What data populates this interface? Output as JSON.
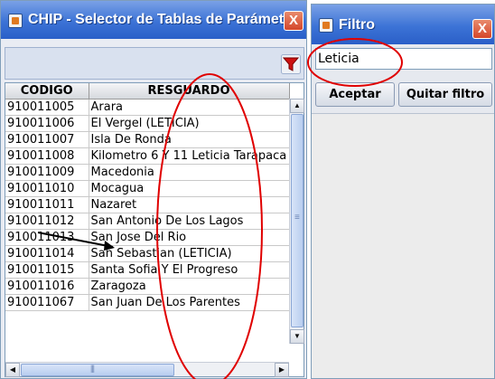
{
  "main_window": {
    "title": "CHIP - Selector de Tablas de Parámet...",
    "close_label": "X",
    "table": {
      "headers": [
        "CODIGO",
        "RESGUARDO"
      ],
      "rows": [
        [
          "910011005",
          "Arara"
        ],
        [
          "910011006",
          "El Vergel (LETICIA)"
        ],
        [
          "910011007",
          "Isla De Ronda"
        ],
        [
          "910011008",
          "Kilometro 6 Y 11 Leticia Tarapaca"
        ],
        [
          "910011009",
          "Macedonia"
        ],
        [
          "910011010",
          "Mocagua"
        ],
        [
          "910011011",
          "Nazaret"
        ],
        [
          "910011012",
          "San Antonio De Los Lagos"
        ],
        [
          "910011013",
          "San Jose Del Rio"
        ],
        [
          "910011014",
          "San Sebastian (LETICIA)"
        ],
        [
          "910011015",
          "Santa Sofia Y El Progreso"
        ],
        [
          "910011016",
          "Zaragoza"
        ],
        [
          "910011067",
          "San Juan De Los Parentes"
        ]
      ]
    }
  },
  "filter_window": {
    "title": "Filtro",
    "close_label": "X",
    "input_value": "Leticia",
    "accept_label": "Aceptar",
    "clear_label": "Quitar filtro"
  },
  "colors": {
    "titlebar": "#3c73d6",
    "close": "#d4462b",
    "annotation": "#e00000",
    "filter_icon": "#cc1111"
  },
  "icons": [
    "app-icon",
    "close-icon",
    "filter-icon"
  ]
}
